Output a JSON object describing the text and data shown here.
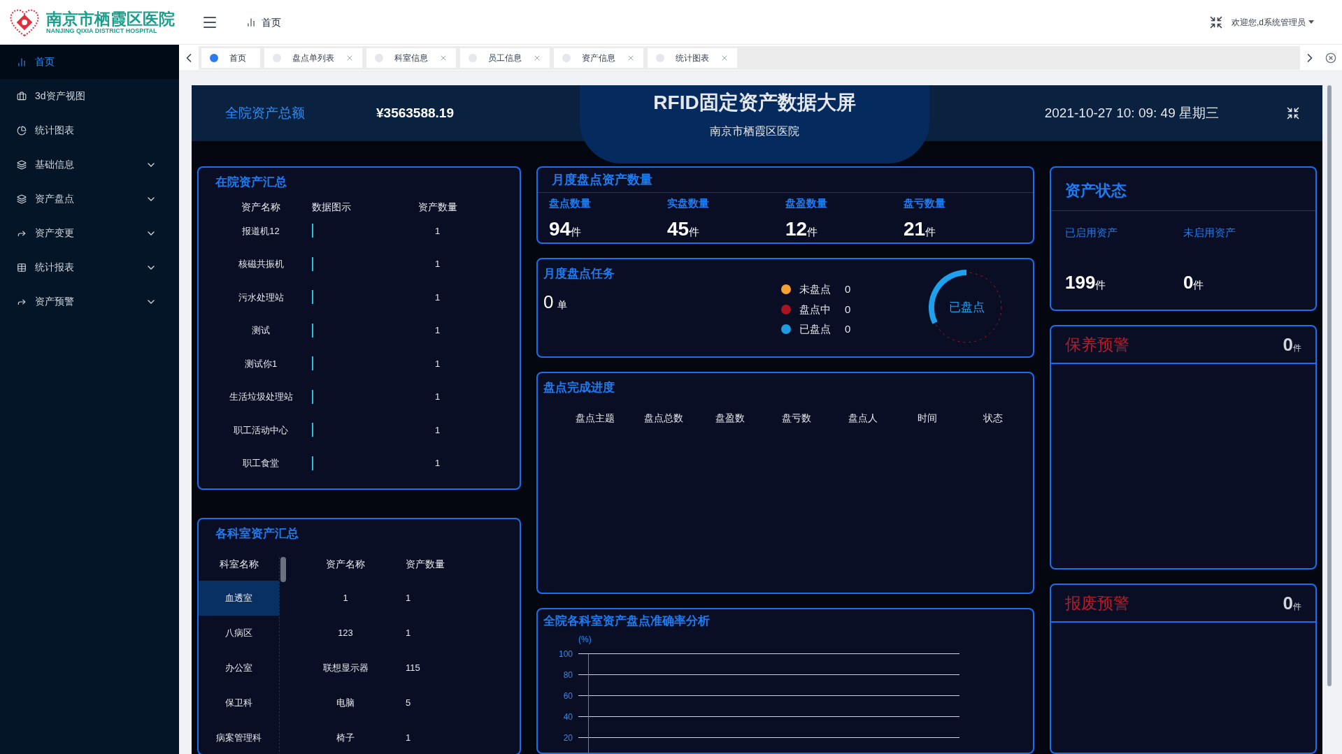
{
  "logo": {
    "title": "南京市栖霞区医院",
    "subtitle": "NANJING QIXIA DISTRICT HOSPITAL"
  },
  "breadcrumb": "首页",
  "user": "欢迎您,d系统管理员",
  "sidebar": {
    "items": [
      {
        "label": "首页",
        "selected": true,
        "expandable": false
      },
      {
        "label": "3d资产视图",
        "selected": false,
        "expandable": false
      },
      {
        "label": "统计图表",
        "selected": false,
        "expandable": false
      },
      {
        "label": "基础信息",
        "selected": false,
        "expandable": true
      },
      {
        "label": "资产盘点",
        "selected": false,
        "expandable": true
      },
      {
        "label": "资产变更",
        "selected": false,
        "expandable": true
      },
      {
        "label": "统计报表",
        "selected": false,
        "expandable": true
      },
      {
        "label": "资产预警",
        "selected": false,
        "expandable": true
      }
    ]
  },
  "tabs": [
    {
      "label": "首页",
      "selected": true,
      "closable": false
    },
    {
      "label": "盘点单列表",
      "selected": false,
      "closable": true
    },
    {
      "label": "科室信息",
      "selected": false,
      "closable": true
    },
    {
      "label": "员工信息",
      "selected": false,
      "closable": true
    },
    {
      "label": "资产信息",
      "selected": false,
      "closable": true
    },
    {
      "label": "统计图表",
      "selected": false,
      "closable": true
    }
  ],
  "dashboard": {
    "total_label": "全院资产总额",
    "total_value": "¥3563588.19",
    "title": "RFID固定资产数据大屏",
    "subtitle": "南京市栖霞区医院",
    "datetime": "2021-10-27 10: 09: 49 星期三"
  },
  "asset_summary": {
    "title": "在院资产汇总",
    "columns": [
      "资产名称",
      "数据图示",
      "资产数量"
    ],
    "rows": [
      {
        "name": "报道机12",
        "count": "1"
      },
      {
        "name": "核磁共振机",
        "count": "1"
      },
      {
        "name": "污水处理站",
        "count": "1"
      },
      {
        "name": "测试",
        "count": "1"
      },
      {
        "name": "测试你1",
        "count": "1"
      },
      {
        "name": "生活垃圾处理站",
        "count": "1"
      },
      {
        "name": "职工活动中心",
        "count": "1"
      },
      {
        "name": "职工食堂",
        "count": "1"
      }
    ]
  },
  "dept_summary": {
    "title": "各科室资产汇总",
    "columns": [
      "科室名称",
      "资产名称",
      "资产数量"
    ],
    "rows": [
      {
        "dept": "血透室",
        "selected": true,
        "asset": "1",
        "count": "1"
      },
      {
        "dept": "八病区",
        "selected": false,
        "asset": "123",
        "count": "1"
      },
      {
        "dept": "办公室",
        "selected": false,
        "asset": "联想显示器",
        "count": "115"
      },
      {
        "dept": "保卫科",
        "selected": false,
        "asset": "电脑",
        "count": "5"
      },
      {
        "dept": "病案管理科",
        "selected": false,
        "asset": "椅子",
        "count": "1"
      }
    ]
  },
  "monthly_count": {
    "title": "月度盘点资产数量",
    "stats": [
      {
        "label": "盘点数量",
        "value": "94",
        "unit": "件"
      },
      {
        "label": "实盘数量",
        "value": "45",
        "unit": "件"
      },
      {
        "label": "盘盈数量",
        "value": "12",
        "unit": "件"
      },
      {
        "label": "盘亏数量",
        "value": "21",
        "unit": "件"
      }
    ]
  },
  "monthly_task": {
    "title": "月度盘点任务",
    "value": "0",
    "unit": "单",
    "legend": [
      {
        "label": "未盘点",
        "value": "0",
        "color": "#f6a134"
      },
      {
        "label": "盘点中",
        "value": "0",
        "color": "#a8141f"
      },
      {
        "label": "已盘点",
        "value": "0",
        "color": "#1f9be0"
      }
    ],
    "gauge_label": "已盘点"
  },
  "progress": {
    "title": "盘点完成进度",
    "columns": [
      "盘点主题",
      "盘点总数",
      "盘盈数",
      "盘亏数",
      "盘点人",
      "时间",
      "状态"
    ]
  },
  "accuracy": {
    "title": "全院各科室资产盘点准确率分析",
    "axis_unit": "(%)",
    "axis_ticks": [
      "100",
      "80",
      "60",
      "40",
      "20"
    ]
  },
  "asset_status": {
    "title": "资产状态",
    "stats": [
      {
        "label": "已启用资产",
        "value": "199",
        "unit": "件"
      },
      {
        "label": "未启用资产",
        "value": "0",
        "unit": "件"
      }
    ]
  },
  "warnings": [
    {
      "title": "保养预警",
      "value": "0",
      "unit": "件"
    },
    {
      "title": "报废预警",
      "value": "0",
      "unit": "件"
    }
  ]
}
